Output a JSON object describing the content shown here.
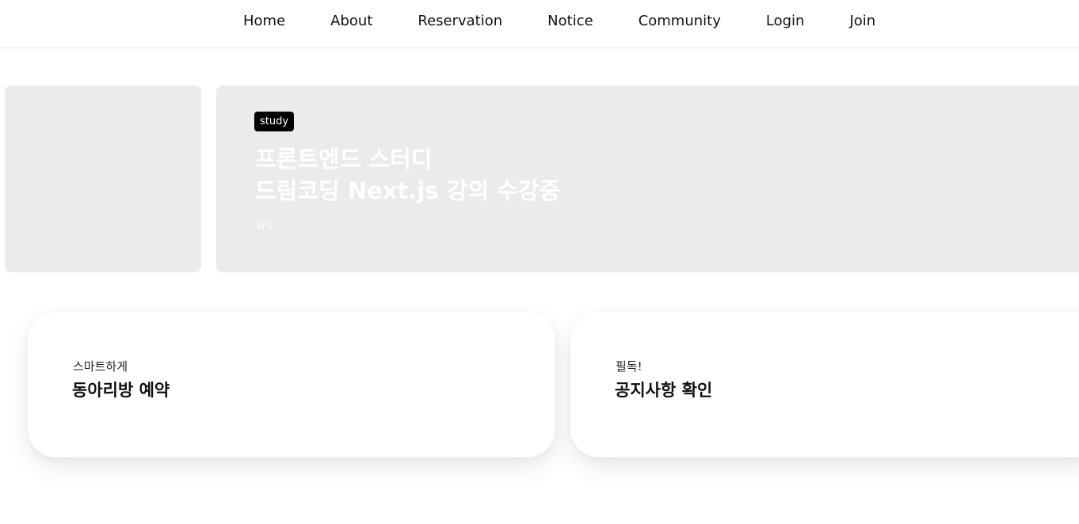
{
  "nav": {
    "items": [
      {
        "label": "Home"
      },
      {
        "label": "About"
      },
      {
        "label": "Reservation"
      },
      {
        "label": "Notice"
      },
      {
        "label": "Community"
      },
      {
        "label": "Login"
      },
      {
        "label": "Join"
      }
    ]
  },
  "hero": {
    "slides": [
      {
        "tag": "study",
        "title_line1": "프론트엔드 스터디",
        "title_line2": "드림코딩 Next.js 강의 수강중",
        "author": "SFS"
      }
    ]
  },
  "cards": [
    {
      "caption": "스마트하게",
      "title": "동아리방 예약"
    },
    {
      "caption": "필독!",
      "title": "공지사항 확인"
    }
  ]
}
